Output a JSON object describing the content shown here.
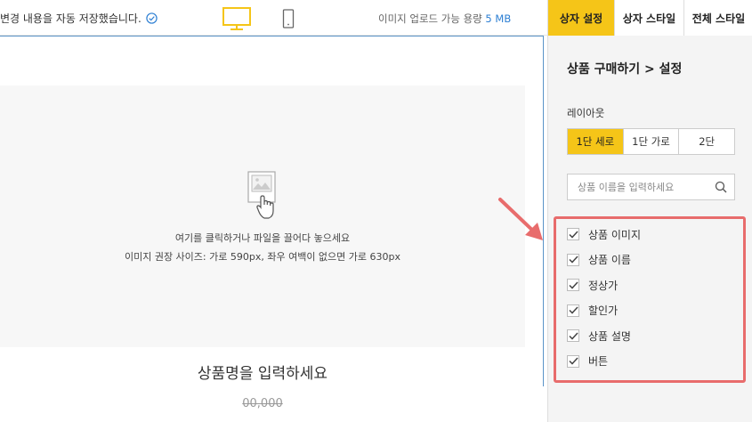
{
  "topbar": {
    "autosave_text": "변경 내용을 자동 저장했습니다.",
    "upload_label": "이미지 업로드 가능 용량",
    "upload_value": "5 MB"
  },
  "canvas": {
    "drop_line1": "여기를 클릭하거나 파일을 끌어다 놓으세요",
    "drop_line2": "이미지 권장 사이즈: 가로 590px, 좌우 여백이 없으면 가로 630px",
    "product_name": "상품명을 입력하세요",
    "price": "00,000"
  },
  "panel": {
    "tabs": [
      {
        "label": "상자 설정",
        "active": true
      },
      {
        "label": "상자 스타일",
        "active": false
      },
      {
        "label": "전체 스타일",
        "active": false
      }
    ],
    "title": "상품 구매하기 > 설정",
    "layout_label": "레이아웃",
    "layout_options": [
      {
        "label": "1단 세로",
        "active": true
      },
      {
        "label": "1단 가로",
        "active": false
      },
      {
        "label": "2단",
        "active": false
      }
    ],
    "search_placeholder": "상품 이름을 입력하세요",
    "checklist": [
      {
        "label": "상품 이미지",
        "checked": true
      },
      {
        "label": "상품 이름",
        "checked": true
      },
      {
        "label": "정상가",
        "checked": true
      },
      {
        "label": "할인가",
        "checked": true
      },
      {
        "label": "상품 설명",
        "checked": true
      },
      {
        "label": "버튼",
        "checked": true
      }
    ]
  },
  "colors": {
    "accent_yellow": "#f5c518",
    "link_blue": "#2d7fd3",
    "annotation_red": "#e86c6c"
  },
  "icons": [
    "check-circle-icon",
    "desktop-icon",
    "mobile-icon",
    "image-placeholder-icon",
    "search-icon",
    "checkmark-icon",
    "annotation-arrow-icon"
  ]
}
